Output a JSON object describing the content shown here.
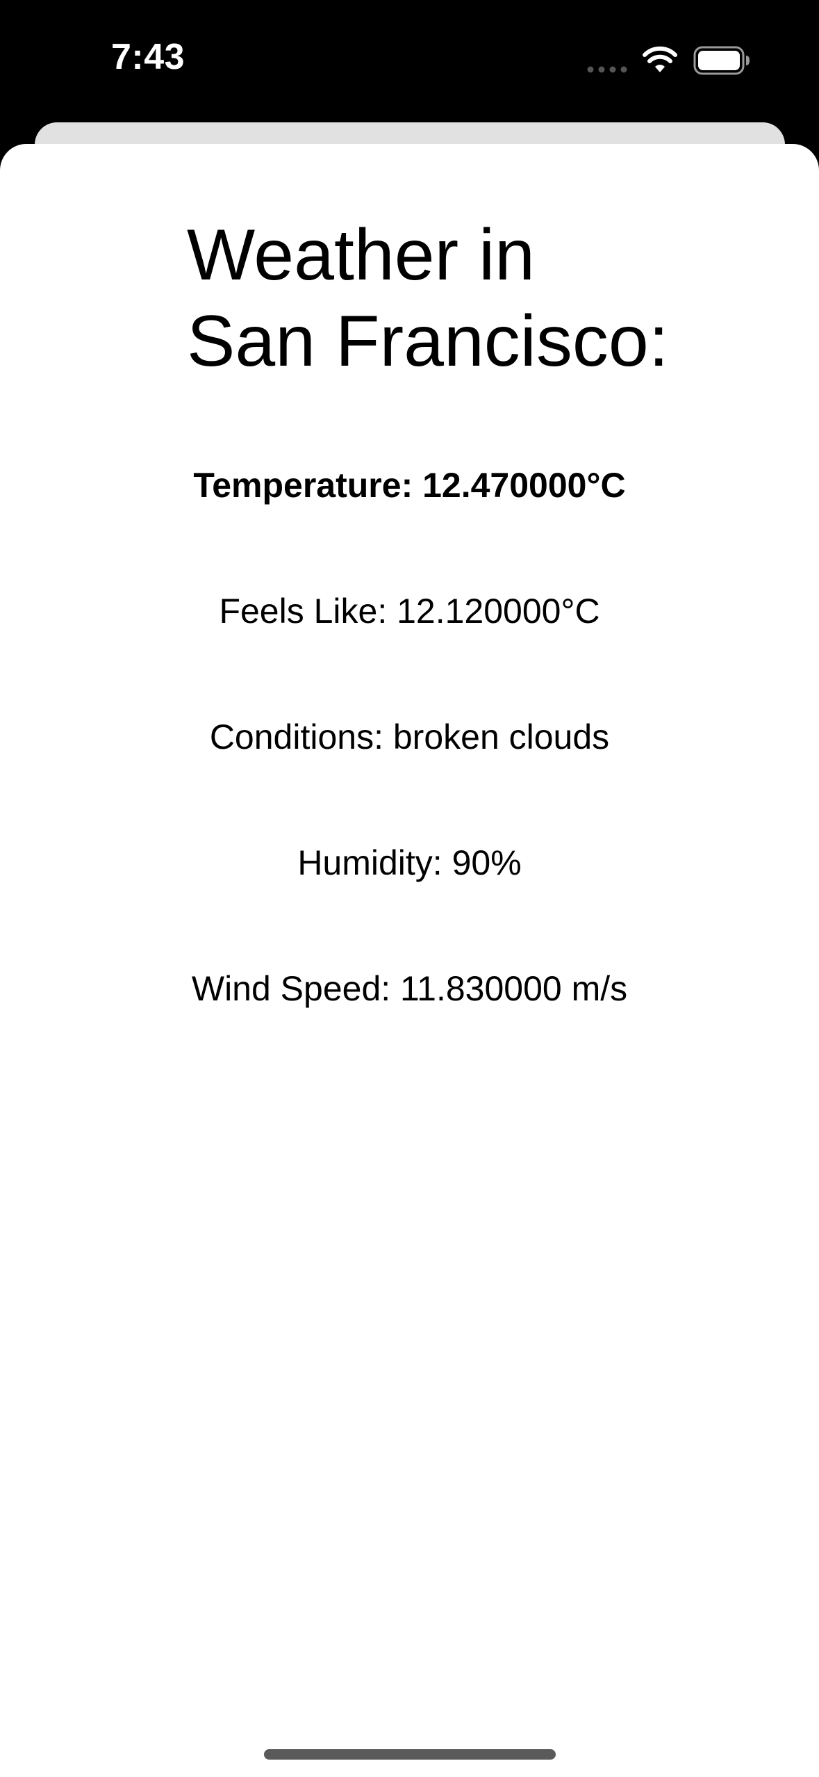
{
  "status_bar": {
    "time": "7:43",
    "icons": [
      "cellular-dots-icon",
      "wifi-icon",
      "battery-icon"
    ]
  },
  "weather": {
    "title_line1": "Weather in",
    "title_line2": "San Francisco:",
    "temperature": "Temperature: 12.470000°C",
    "feels_like": "Feels Like: 12.120000°C",
    "conditions": "Conditions: broken clouds",
    "humidity": "Humidity: 90%",
    "wind_speed": "Wind Speed: 11.830000 m/s"
  },
  "colors": {
    "status_background": "#000000",
    "sheet_background": "#ffffff",
    "sheet_peek": "#e1e1e1",
    "text": "#000000",
    "home_indicator": "#5a5a5a"
  }
}
